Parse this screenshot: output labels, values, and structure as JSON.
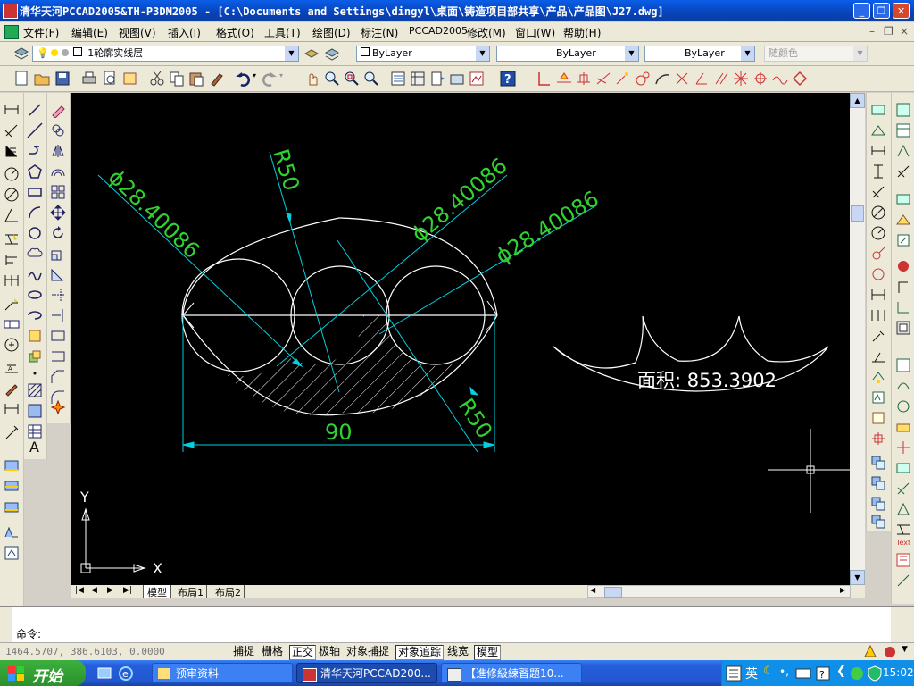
{
  "window": {
    "title": "清华天河PCCAD2005&TH-P3DM2005 - [C:\\Documents and Settings\\dingyl\\桌面\\铸造项目部共享\\产品\\产品图\\J27.dwg]",
    "minimize_label": "_",
    "restore_label": "❐",
    "close_label": "✕"
  },
  "menubar": {
    "items": [
      "文件(F)",
      "编辑(E)",
      "视图(V)",
      "插入(I)",
      "格式(O)",
      "工具(T)",
      "绘图(D)",
      "标注(N)",
      "PCCAD2005",
      "修改(M)",
      "窗口(W)",
      "帮助(H)"
    ],
    "doc_controls": [
      "–",
      "❐",
      "×"
    ]
  },
  "layers_toolbar": {
    "layer_name": "1轮廓实线层",
    "color_value": "ByLayer",
    "linetype_value": "ByLayer",
    "lineweight_value": "ByLayer",
    "plotstyle_value": "随颜色"
  },
  "drawing": {
    "dim_d1": "ϕ28.40086",
    "dim_d2": "ϕ28.40086",
    "dim_d3": "ϕ28.40086",
    "dim_r1": "R50",
    "dim_r2": "R50",
    "dim_len": "90",
    "area_label": "面积: 853.3902",
    "ucs_x": "X",
    "ucs_y": "Y"
  },
  "colors": {
    "dim_text": "#2fd22f",
    "dim_line": "#00d0e0",
    "geometry": "#ffffff",
    "canvas": "#000000"
  },
  "layout_tabs": [
    "模型",
    "布局1",
    "布局2"
  ],
  "command": {
    "prompt": "命令:",
    "value": ""
  },
  "status": {
    "coords": "1464.5707,  386.6103,  0.0000",
    "toggles": [
      "捕捉",
      "栅格",
      "正交",
      "极轴",
      "对象捕捉",
      "对象追踪",
      "线宽",
      "模型"
    ]
  },
  "taskbar": {
    "start_label": "开始",
    "tasks": [
      "预审资料",
      "清华天河PCCAD200...",
      "【進修級練習題10..."
    ],
    "ime_label": "英",
    "clock": "15:02"
  }
}
